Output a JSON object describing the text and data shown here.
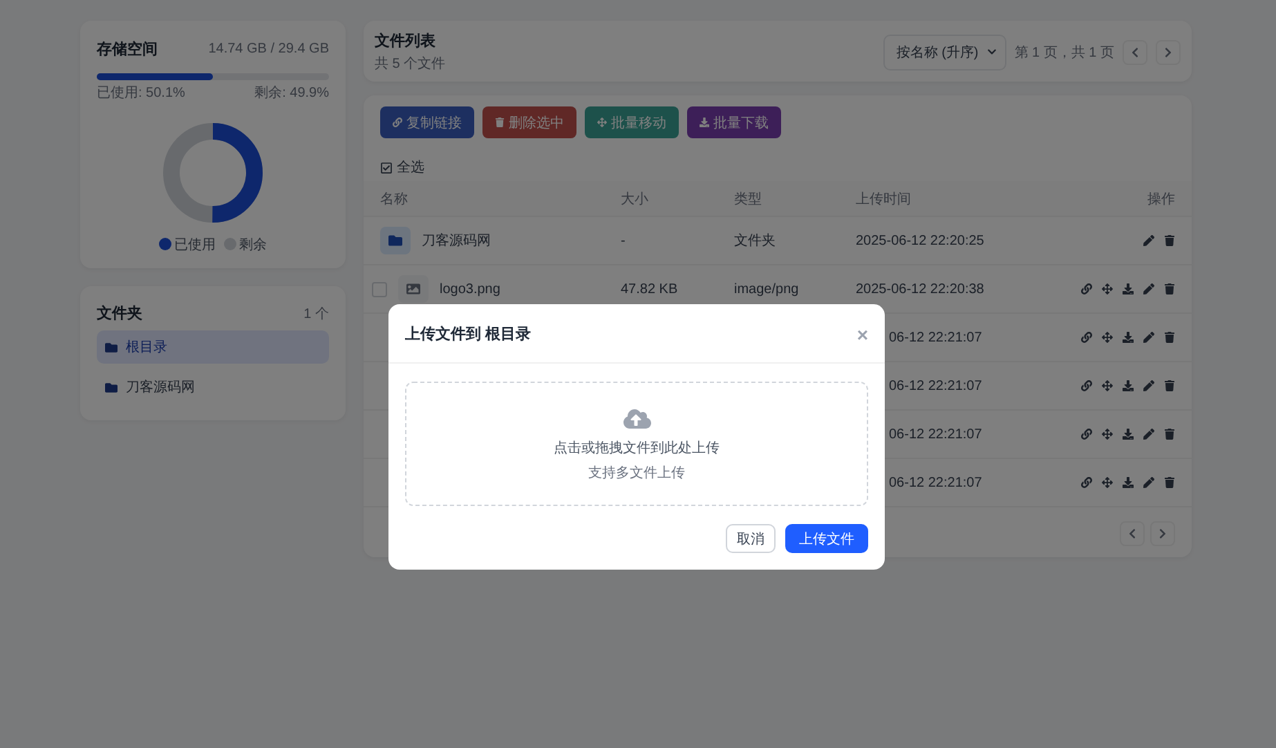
{
  "storage": {
    "title": "存储空间",
    "usage": "14.74 GB / 29.4 GB",
    "level": 0.501,
    "used_label": "已使用: 50.1%",
    "free_label": "剩余: 49.9%",
    "legend": [
      "已使用",
      "剩余"
    ]
  },
  "folders": {
    "title": "文件夹",
    "count": "1 个",
    "items": [
      {
        "name": "根目录",
        "selected": true
      },
      {
        "name": "刀客源码网",
        "selected": false
      }
    ]
  },
  "header": {
    "title": "文件列表",
    "subtitle": "共 5 个文件",
    "sort": "按名称 (升序)",
    "page_info": "第 1 页，共 1 页"
  },
  "toolbar": [
    {
      "kind": "link",
      "label": "复制链接"
    },
    {
      "kind": "trash",
      "label": "删除选中"
    },
    {
      "kind": "move",
      "label": "批量移动"
    },
    {
      "kind": "download",
      "label": "批量下载"
    }
  ],
  "select_all": "全选",
  "table": {
    "columns": [
      "名称",
      "大小",
      "类型",
      "上传时间",
      "操作"
    ],
    "rows": [
      {
        "kind": "folder",
        "name": "刀客源码网",
        "size": "-",
        "type": "文件夹",
        "time": "2025-06-12 22:20:25"
      },
      {
        "kind": "file",
        "checked": false,
        "name": "logo3.png",
        "size": "47.82 KB",
        "type": "image/png",
        "time": "2025-06-12 22:20:38"
      },
      {
        "kind": "covered",
        "time": "06-12 22:21:07"
      },
      {
        "kind": "covered",
        "time": "06-12 22:21:07"
      },
      {
        "kind": "covered",
        "time": "06-12 22:21:07"
      },
      {
        "kind": "covered",
        "time": "06-12 22:21:07"
      }
    ]
  },
  "modal": {
    "title": "上传文件到 根目录",
    "close": "×",
    "drop_text": "点击或拖拽文件到此处上传",
    "drop_hint": "支持多文件上传",
    "buttons": [
      {
        "kind": "secondary",
        "label": "取消"
      },
      {
        "kind": "primary",
        "label": "上传文件"
      }
    ]
  }
}
